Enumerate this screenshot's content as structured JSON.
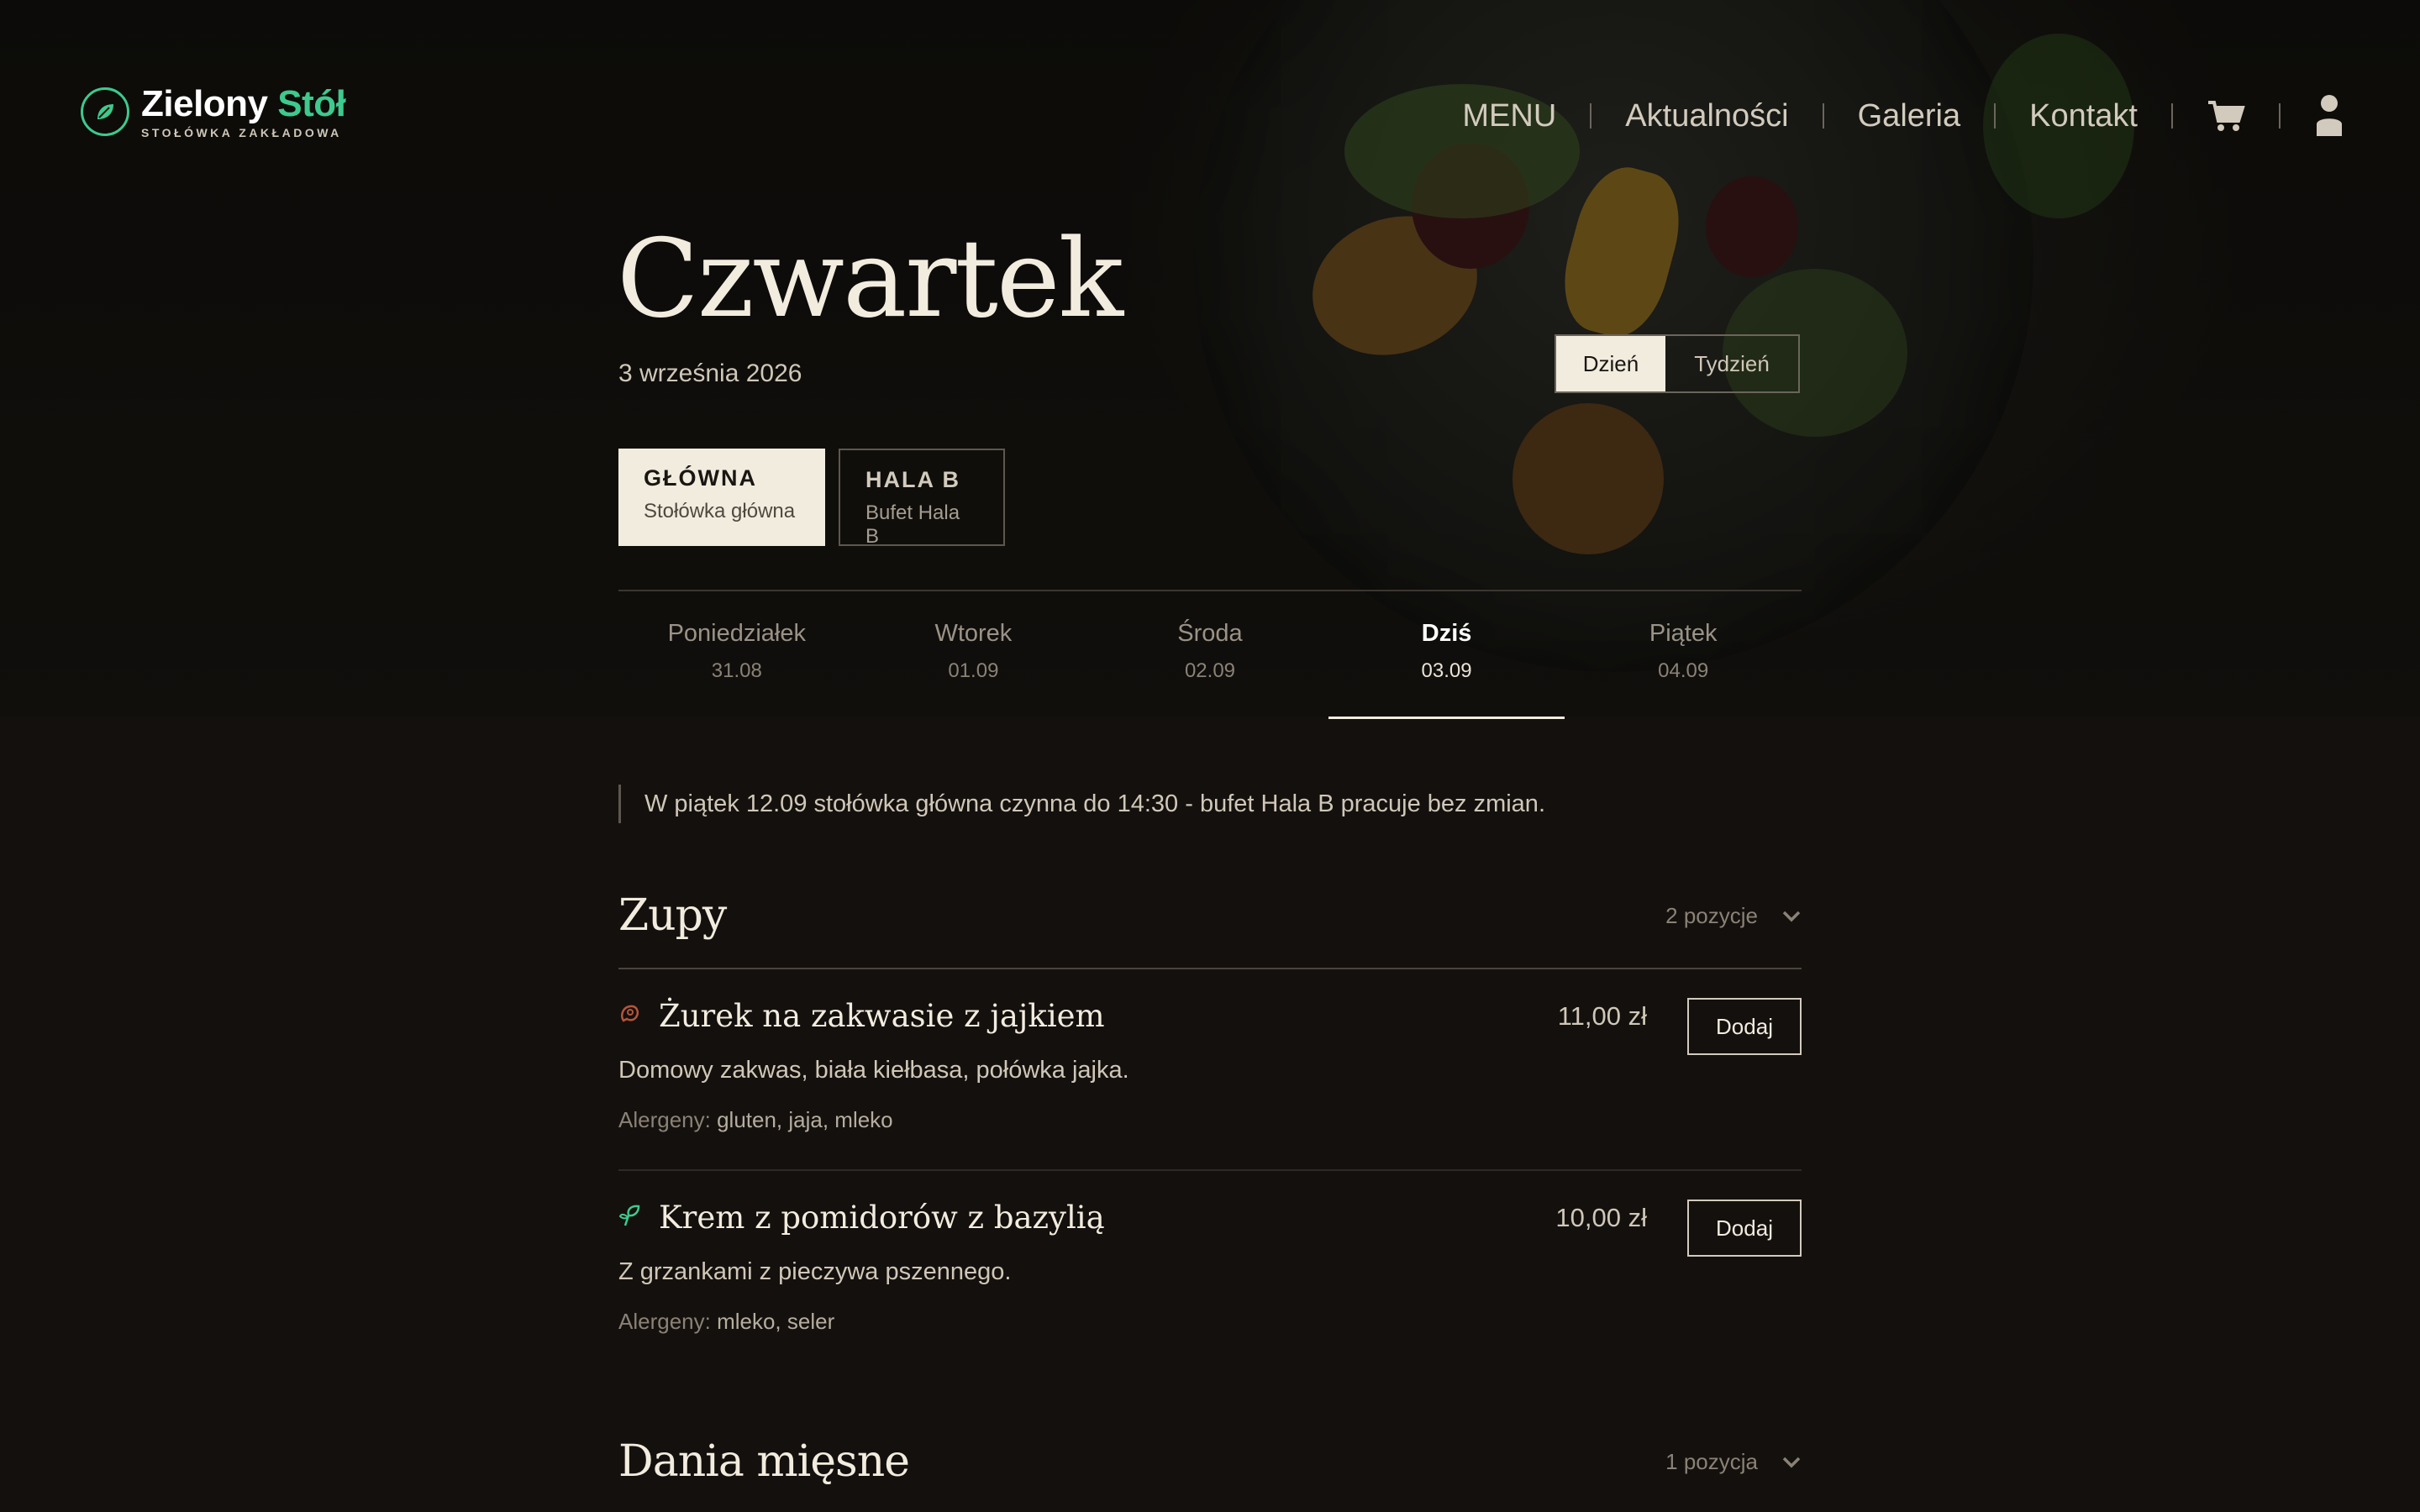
{
  "brand": {
    "name_main": "Zielony",
    "name_accent": "Stół",
    "tagline": "STOŁÓWKA ZAKŁADOWA"
  },
  "nav": {
    "items": [
      "MENU",
      "Aktualności",
      "Galeria",
      "Kontakt"
    ],
    "cart_icon": "cart-icon",
    "user_icon": "user-icon"
  },
  "header": {
    "day": "Czwartek",
    "date": "3 września 2026"
  },
  "view_toggle": {
    "day": "Dzień",
    "week": "Tydzień",
    "selected": "Dzień"
  },
  "locations": [
    {
      "code": "GŁÓWNA",
      "label": "Stołówka główna",
      "selected": true
    },
    {
      "code": "HALA B",
      "label": "Bufet Hala B",
      "selected": false
    }
  ],
  "days": [
    {
      "name": "Poniedziałek",
      "date": "31.08"
    },
    {
      "name": "Wtorek",
      "date": "01.09"
    },
    {
      "name": "Środa",
      "date": "02.09"
    },
    {
      "name": "Dziś",
      "date": "03.09",
      "active": true
    },
    {
      "name": "Piątek",
      "date": "04.09"
    }
  ],
  "notice": "W piątek 12.09 stołówka główna czynna do 14:30 - bufet Hala B pracuje bez zmian.",
  "sections": [
    {
      "title": "Zupy",
      "count": "2 pozycje",
      "items": [
        {
          "icon": "meat-icon",
          "name": "Żurek na zakwasie z jajkiem",
          "price": "11,00 zł",
          "desc": "Domowy zakwas, biała kiełbasa, połówka jajka.",
          "allergens_label": "Alergeny:",
          "allergens": "gluten, jaja, mleko",
          "button": "Dodaj"
        },
        {
          "icon": "vegetarian-leaf-icon",
          "name": "Krem z pomidorów z bazylią",
          "price": "10,00 zł",
          "desc": "Z grzankami z pieczywa pszennego.",
          "allergens_label": "Alergeny:",
          "allergens": "mleko, seler",
          "button": "Dodaj"
        }
      ]
    },
    {
      "title": "Dania mięsne",
      "count": "1 pozycja"
    }
  ],
  "colors": {
    "accent": "#3ec98d",
    "background": "#14100d",
    "cream": "#f2ecdf"
  }
}
